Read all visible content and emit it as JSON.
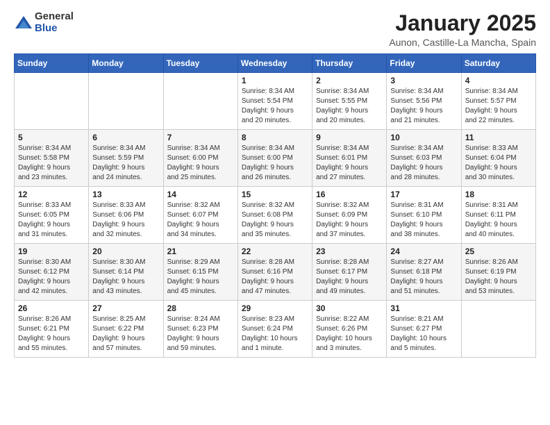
{
  "logo": {
    "general": "General",
    "blue": "Blue"
  },
  "header": {
    "title": "January 2025",
    "subtitle": "Aunon, Castille-La Mancha, Spain"
  },
  "weekdays": [
    "Sunday",
    "Monday",
    "Tuesday",
    "Wednesday",
    "Thursday",
    "Friday",
    "Saturday"
  ],
  "weeks": [
    [
      {
        "day": "",
        "info": ""
      },
      {
        "day": "",
        "info": ""
      },
      {
        "day": "",
        "info": ""
      },
      {
        "day": "1",
        "info": "Sunrise: 8:34 AM\nSunset: 5:54 PM\nDaylight: 9 hours\nand 20 minutes."
      },
      {
        "day": "2",
        "info": "Sunrise: 8:34 AM\nSunset: 5:55 PM\nDaylight: 9 hours\nand 20 minutes."
      },
      {
        "day": "3",
        "info": "Sunrise: 8:34 AM\nSunset: 5:56 PM\nDaylight: 9 hours\nand 21 minutes."
      },
      {
        "day": "4",
        "info": "Sunrise: 8:34 AM\nSunset: 5:57 PM\nDaylight: 9 hours\nand 22 minutes."
      }
    ],
    [
      {
        "day": "5",
        "info": "Sunrise: 8:34 AM\nSunset: 5:58 PM\nDaylight: 9 hours\nand 23 minutes."
      },
      {
        "day": "6",
        "info": "Sunrise: 8:34 AM\nSunset: 5:59 PM\nDaylight: 9 hours\nand 24 minutes."
      },
      {
        "day": "7",
        "info": "Sunrise: 8:34 AM\nSunset: 6:00 PM\nDaylight: 9 hours\nand 25 minutes."
      },
      {
        "day": "8",
        "info": "Sunrise: 8:34 AM\nSunset: 6:00 PM\nDaylight: 9 hours\nand 26 minutes."
      },
      {
        "day": "9",
        "info": "Sunrise: 8:34 AM\nSunset: 6:01 PM\nDaylight: 9 hours\nand 27 minutes."
      },
      {
        "day": "10",
        "info": "Sunrise: 8:34 AM\nSunset: 6:03 PM\nDaylight: 9 hours\nand 28 minutes."
      },
      {
        "day": "11",
        "info": "Sunrise: 8:33 AM\nSunset: 6:04 PM\nDaylight: 9 hours\nand 30 minutes."
      }
    ],
    [
      {
        "day": "12",
        "info": "Sunrise: 8:33 AM\nSunset: 6:05 PM\nDaylight: 9 hours\nand 31 minutes."
      },
      {
        "day": "13",
        "info": "Sunrise: 8:33 AM\nSunset: 6:06 PM\nDaylight: 9 hours\nand 32 minutes."
      },
      {
        "day": "14",
        "info": "Sunrise: 8:32 AM\nSunset: 6:07 PM\nDaylight: 9 hours\nand 34 minutes."
      },
      {
        "day": "15",
        "info": "Sunrise: 8:32 AM\nSunset: 6:08 PM\nDaylight: 9 hours\nand 35 minutes."
      },
      {
        "day": "16",
        "info": "Sunrise: 8:32 AM\nSunset: 6:09 PM\nDaylight: 9 hours\nand 37 minutes."
      },
      {
        "day": "17",
        "info": "Sunrise: 8:31 AM\nSunset: 6:10 PM\nDaylight: 9 hours\nand 38 minutes."
      },
      {
        "day": "18",
        "info": "Sunrise: 8:31 AM\nSunset: 6:11 PM\nDaylight: 9 hours\nand 40 minutes."
      }
    ],
    [
      {
        "day": "19",
        "info": "Sunrise: 8:30 AM\nSunset: 6:12 PM\nDaylight: 9 hours\nand 42 minutes."
      },
      {
        "day": "20",
        "info": "Sunrise: 8:30 AM\nSunset: 6:14 PM\nDaylight: 9 hours\nand 43 minutes."
      },
      {
        "day": "21",
        "info": "Sunrise: 8:29 AM\nSunset: 6:15 PM\nDaylight: 9 hours\nand 45 minutes."
      },
      {
        "day": "22",
        "info": "Sunrise: 8:28 AM\nSunset: 6:16 PM\nDaylight: 9 hours\nand 47 minutes."
      },
      {
        "day": "23",
        "info": "Sunrise: 8:28 AM\nSunset: 6:17 PM\nDaylight: 9 hours\nand 49 minutes."
      },
      {
        "day": "24",
        "info": "Sunrise: 8:27 AM\nSunset: 6:18 PM\nDaylight: 9 hours\nand 51 minutes."
      },
      {
        "day": "25",
        "info": "Sunrise: 8:26 AM\nSunset: 6:19 PM\nDaylight: 9 hours\nand 53 minutes."
      }
    ],
    [
      {
        "day": "26",
        "info": "Sunrise: 8:26 AM\nSunset: 6:21 PM\nDaylight: 9 hours\nand 55 minutes."
      },
      {
        "day": "27",
        "info": "Sunrise: 8:25 AM\nSunset: 6:22 PM\nDaylight: 9 hours\nand 57 minutes."
      },
      {
        "day": "28",
        "info": "Sunrise: 8:24 AM\nSunset: 6:23 PM\nDaylight: 9 hours\nand 59 minutes."
      },
      {
        "day": "29",
        "info": "Sunrise: 8:23 AM\nSunset: 6:24 PM\nDaylight: 10 hours\nand 1 minute."
      },
      {
        "day": "30",
        "info": "Sunrise: 8:22 AM\nSunset: 6:26 PM\nDaylight: 10 hours\nand 3 minutes."
      },
      {
        "day": "31",
        "info": "Sunrise: 8:21 AM\nSunset: 6:27 PM\nDaylight: 10 hours\nand 5 minutes."
      },
      {
        "day": "",
        "info": ""
      }
    ]
  ]
}
